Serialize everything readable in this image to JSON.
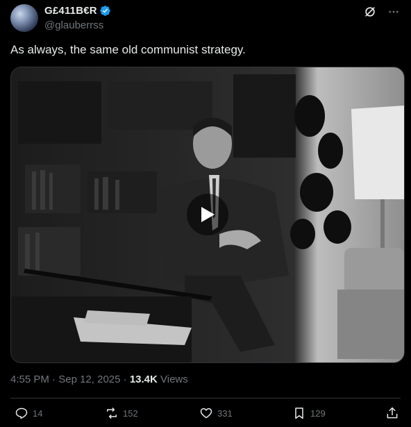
{
  "author": {
    "display_name": "G£411B€R",
    "handle": "@glauberrss"
  },
  "tweet": {
    "text": "As always, the same old communist strategy."
  },
  "meta": {
    "time": "4:55 PM",
    "date": "Sep 12, 2025",
    "views_count": "13.4K",
    "views_label": "Views"
  },
  "actions": {
    "replies": "14",
    "reposts": "152",
    "likes": "331",
    "bookmarks": "129"
  },
  "colors": {
    "verified": "#1d9bf0",
    "muted": "#71767b",
    "text": "#e7e9ea"
  }
}
